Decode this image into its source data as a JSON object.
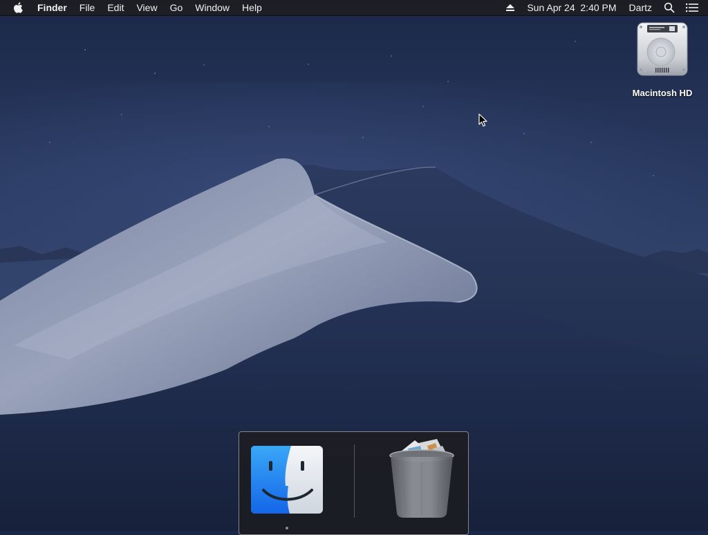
{
  "menubar": {
    "app_name": "Finder",
    "menus": [
      "File",
      "Edit",
      "View",
      "Go",
      "Window",
      "Help"
    ],
    "clock": "Sun Apr 24  2:40 PM",
    "user": "Dartz",
    "icons": [
      "apple-logo-icon",
      "eject-icon",
      "spotlight-search-icon",
      "notification-center-icon"
    ]
  },
  "desktop": {
    "wallpaper": "mojave-night-dunes",
    "icons": [
      {
        "label": "Macintosh HD",
        "icon": "hard-drive-icon"
      }
    ]
  },
  "dock": {
    "apps": [
      {
        "name": "Finder",
        "icon": "finder-icon",
        "running": true
      },
      {
        "name": "Trash",
        "icon": "trash-full-icon",
        "running": false
      }
    ]
  },
  "colors": {
    "sky_top": "#1a2747",
    "sky_mid": "#2b3b63",
    "dune_light": "#a3acc4",
    "menubar_bg": "#1e1e20",
    "finder_blue": "#1d7bf5"
  }
}
